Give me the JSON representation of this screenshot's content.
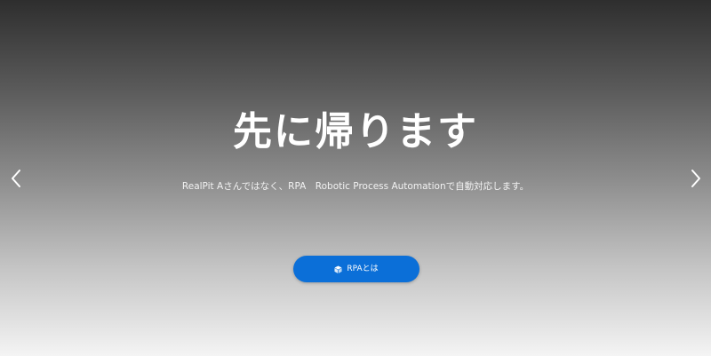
{
  "hero": {
    "title": "先に帰ります",
    "subtitle": "RealPit Aさんではなく、RPA　Robotic Process Automationで自動対応します。",
    "cta_label": "RPAとは",
    "cta_icon": "cube-icon",
    "prev_icon": "chevron-left-icon",
    "next_icon": "chevron-right-icon"
  },
  "colors": {
    "cta_background": "#0b6fd8",
    "text": "#ffffff",
    "gradient_top": "#2e2e2e",
    "gradient_bottom": "#f4f4f4"
  }
}
